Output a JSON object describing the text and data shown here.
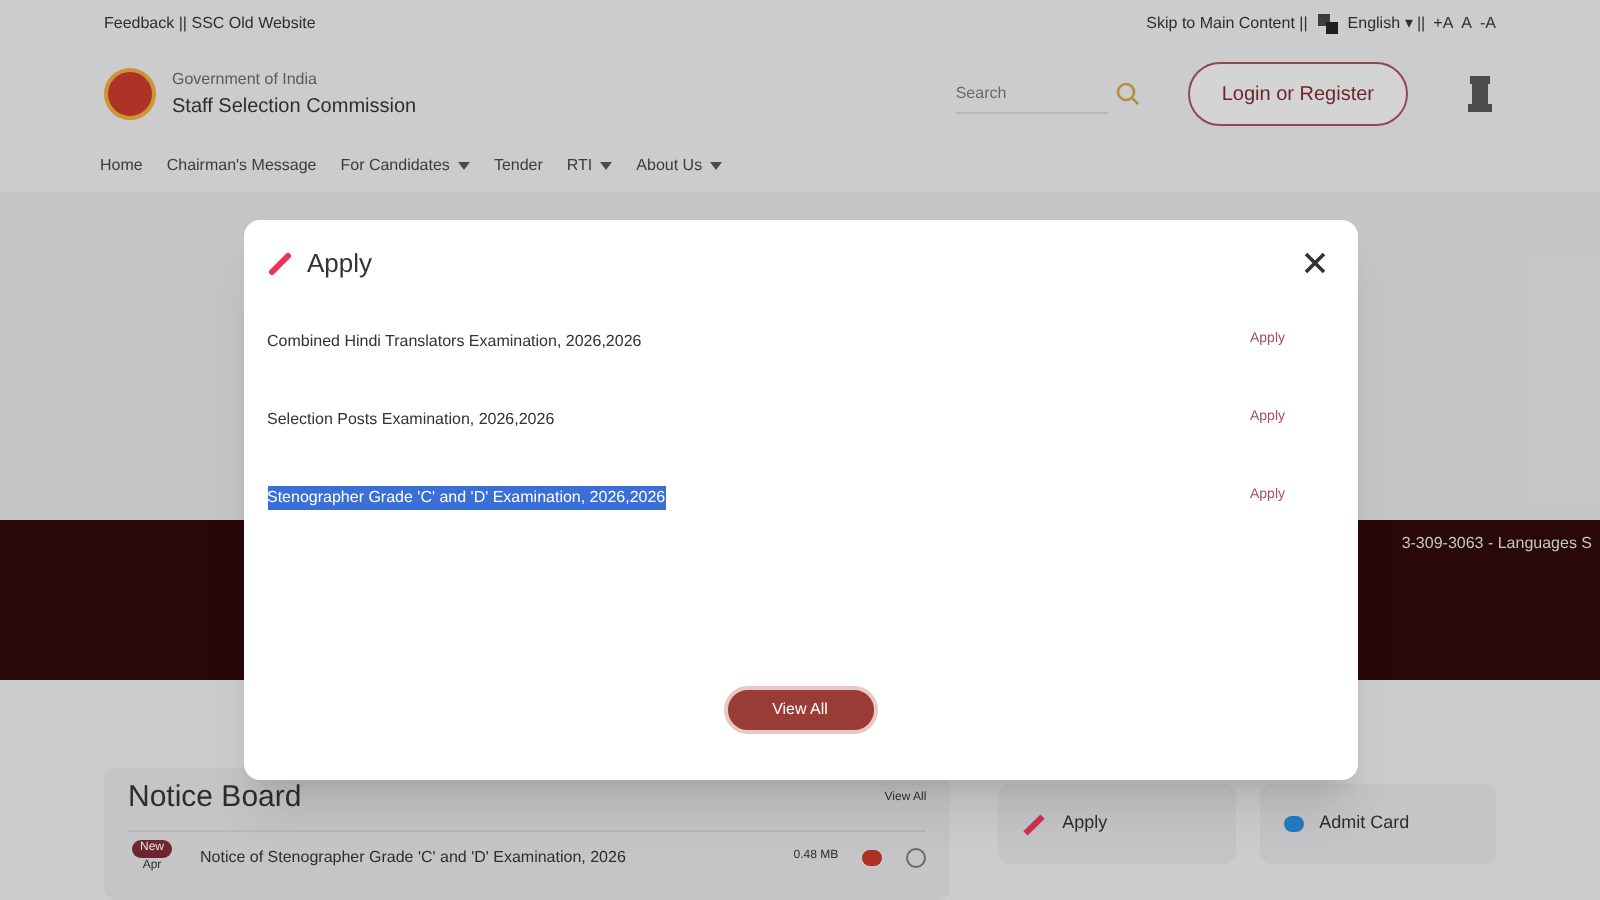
{
  "top_bar": {
    "left": "Feedback || SSC Old Website",
    "skip": "Skip to Main Content ||",
    "language": "English ▾ ||",
    "font_sizes": [
      "+A",
      "A",
      "-A"
    ]
  },
  "header": {
    "org_line": "Government of India",
    "org_name": "Staff Selection Commission",
    "search": {
      "placeholder": "Search"
    },
    "login": "Login or Register"
  },
  "nav": [
    {
      "label": "Home",
      "dropdown": false
    },
    {
      "label": "Chairman's Message",
      "dropdown": false
    },
    {
      "label": "For Candidates",
      "dropdown": true
    },
    {
      "label": "Tender",
      "dropdown": false
    },
    {
      "label": "RTI",
      "dropdown": true
    },
    {
      "label": "About Us",
      "dropdown": true
    }
  ],
  "banner": {
    "ticker": "3-309-3063 - Languages S"
  },
  "notice_board": {
    "title": "Notice Board",
    "view_all": "View All",
    "items": [
      {
        "badge": "New",
        "month": "Apr",
        "title": "Notice of Stenographer Grade 'C' and 'D' Examination, 2026",
        "size": "0.48 MB"
      }
    ]
  },
  "quick_links": [
    {
      "label": "Apply",
      "kind": "pencil"
    },
    {
      "label": "Admit Card",
      "kind": "card"
    }
  ],
  "modal": {
    "title": "Apply",
    "rows": [
      {
        "name": "Combined Hindi Translators Examination, 2026,2026",
        "action": "Apply",
        "highlighted": false
      },
      {
        "name": "Selection Posts Examination, 2026,2026",
        "action": "Apply",
        "highlighted": false
      },
      {
        "name": "Stenographer Grade 'C' and 'D' Examination, 2026,2026",
        "action": "Apply",
        "highlighted": true
      }
    ],
    "view_all": "View All"
  }
}
